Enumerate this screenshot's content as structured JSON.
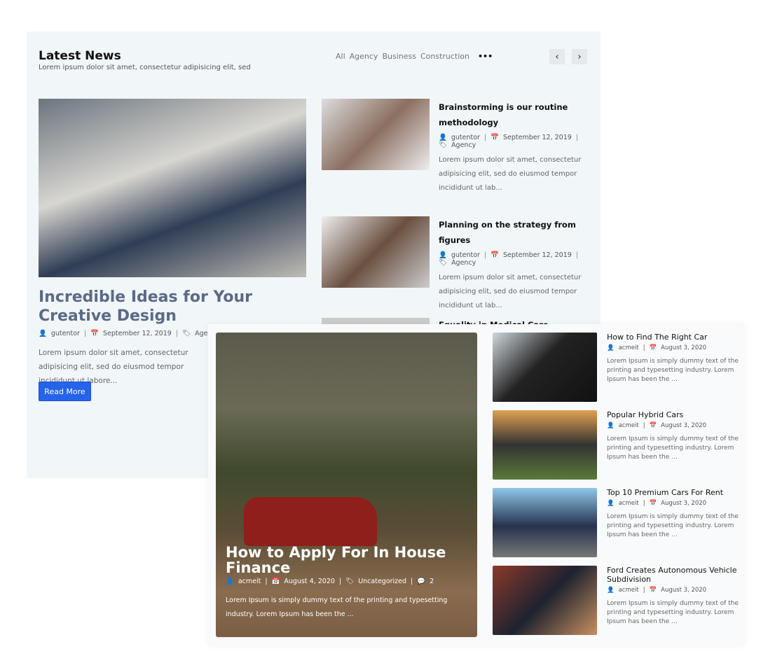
{
  "latest": {
    "title": "Latest News",
    "subtitle": "Lorem ipsum dolor sit amet, consectetur adipisicing elit, sed",
    "filters": [
      "All",
      "Agency",
      "Business",
      "Construction"
    ],
    "more": "•••",
    "prev": "‹",
    "next": "›",
    "featured": {
      "title": "Incredible Ideas for Your Creative Design",
      "author": "gutentor",
      "date": "September 12, 2019",
      "category": "Agency",
      "excerpt": "Lorem ipsum dolor sit amet, consectetur adipisicing elit, sed do eiusmod tempor incididunt ut labore...",
      "button": "Read More"
    },
    "posts": [
      {
        "title": "Brainstorming is our routine methodology",
        "author": "gutentor",
        "date": "September 12, 2019",
        "category": "Agency",
        "excerpt": "Lorem ipsum dolor sit amet, consectetur adipisicing elit, sed do eiusmod tempor incididunt ut lab..."
      },
      {
        "title": "Planning on the strategy from figures",
        "author": "gutentor",
        "date": "September 12, 2019",
        "category": "Agency",
        "excerpt": "Lorem ipsum dolor sit amet, consectetur adipisicing elit, sed do eiusmod tempor incididunt ut lab..."
      },
      {
        "title": "Equality in Medical Care"
      }
    ]
  },
  "cars": {
    "featured": {
      "title": "How to Apply For In House Finance",
      "author": "acmeit",
      "date": "August 4, 2020",
      "category": "Uncategorized",
      "comments": "2",
      "excerpt": "Lorem Ipsum is simply dummy text of the printing and typesetting industry. Lorem Ipsum has been the ..."
    },
    "posts": [
      {
        "title": "How to Find The Right Car",
        "author": "acmeit",
        "date": "August 3, 2020",
        "excerpt": "Lorem Ipsum is simply dummy text of the printing and typesetting industry. Lorem Ipsum has been the ..."
      },
      {
        "title": "Popular Hybrid Cars",
        "author": "acmeit",
        "date": "August 3, 2020",
        "excerpt": "Lorem Ipsum is simply dummy text of the printing and typesetting industry. Lorem Ipsum has been the ..."
      },
      {
        "title": "Top 10 Premium Cars For Rent",
        "author": "acmeit",
        "date": "August 3, 2020",
        "excerpt": "Lorem Ipsum is simply dummy text of the printing and typesetting industry. Lorem Ipsum has been the ..."
      },
      {
        "title": "Ford Creates Autonomous Vehicle Subdivision",
        "author": "acmeit",
        "date": "August 3, 2020",
        "excerpt": "Lorem Ipsum is simply dummy text of the printing and typesetting industry. Lorem Ipsum has been the ..."
      }
    ]
  },
  "colors": {
    "accent": "#2563eb",
    "featured_title": "#5b6a86"
  }
}
